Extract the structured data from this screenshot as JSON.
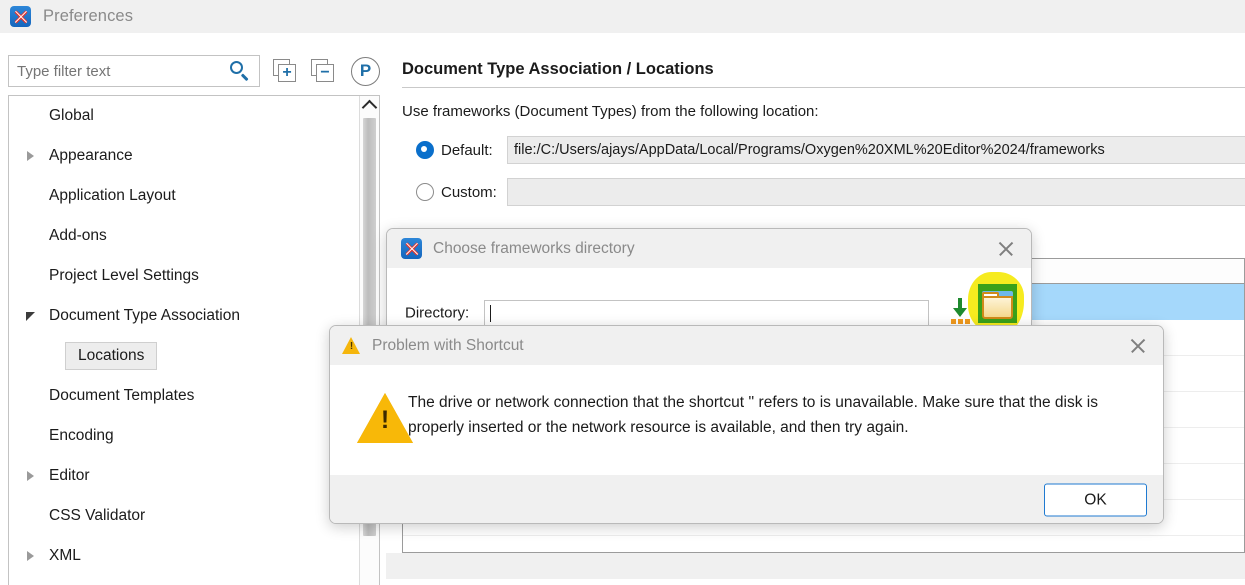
{
  "window": {
    "title": "Preferences",
    "logo_icon": "oxygen-xml-logo-icon"
  },
  "toolbar": {
    "filter_placeholder": "Type filter text",
    "filter_value": "",
    "search_icon": "search-icon",
    "expand_all_icon": "expand-all-icon",
    "collapse_all_icon": "collapse-all-icon",
    "project_options_icon": "project-options-p-icon"
  },
  "sidebar": {
    "scroll_up_icon": "chevron-up-icon",
    "items": [
      {
        "label": "Global",
        "indent": 1,
        "toggle": "none",
        "selected": false
      },
      {
        "label": "Appearance",
        "indent": 1,
        "toggle": "collapsed",
        "selected": false
      },
      {
        "label": "Application Layout",
        "indent": 1,
        "toggle": "none",
        "selected": false
      },
      {
        "label": "Add-ons",
        "indent": 1,
        "toggle": "none",
        "selected": false
      },
      {
        "label": "Project Level Settings",
        "indent": 1,
        "toggle": "none",
        "selected": false
      },
      {
        "label": "Document Type Association",
        "indent": 1,
        "toggle": "expanded",
        "selected": false
      },
      {
        "label": "Locations",
        "indent": 2,
        "toggle": "none",
        "selected": true
      },
      {
        "label": "Document Templates",
        "indent": 1,
        "toggle": "none",
        "selected": false
      },
      {
        "label": "Encoding",
        "indent": 1,
        "toggle": "none",
        "selected": false
      },
      {
        "label": "Editor",
        "indent": 1,
        "toggle": "collapsed",
        "selected": false
      },
      {
        "label": "CSS Validator",
        "indent": 1,
        "toggle": "none",
        "selected": false
      },
      {
        "label": "XML",
        "indent": 1,
        "toggle": "collapsed",
        "selected": false
      }
    ]
  },
  "main": {
    "page_title": "Document Type Association / Locations",
    "hint": "Use frameworks (Document Types) from the following location:",
    "default_option": {
      "label": "Default:",
      "selected": true,
      "value": "file:/C:/Users/ajays/AppData/Local/Programs/Oxygen%20XML%20Editor%2024/frameworks"
    },
    "custom_option": {
      "label": "Custom:",
      "selected": false,
      "value": ""
    }
  },
  "chooser_dialog": {
    "title": "Choose frameworks directory",
    "logo_icon": "oxygen-xml-logo-icon",
    "close_icon": "close-icon",
    "directory_label": "Directory:",
    "directory_value": "",
    "insert_editor_variables_icon": "download-variables-icon",
    "browse_folder_icon": "browse-folder-icon"
  },
  "problem_dialog": {
    "title": "Problem with Shortcut",
    "title_icon": "warning-icon",
    "close_icon": "close-icon",
    "message_icon": "warning-icon",
    "message": "The drive or network connection that the shortcut '' refers to is unavailable. Make sure that the disk is properly inserted or the network resource is available, and then try again.",
    "ok_label": "OK"
  },
  "colors": {
    "accent_blue": "#1f6fa8",
    "radio_blue": "#0a6fcb",
    "selection_blue": "#a5d8fb",
    "warning_yellow": "#f8b808",
    "highlight_yellow": "#f6eb1f",
    "highlight_green": "#3aa01a",
    "titlebar_gray": "#f0f0f0"
  }
}
